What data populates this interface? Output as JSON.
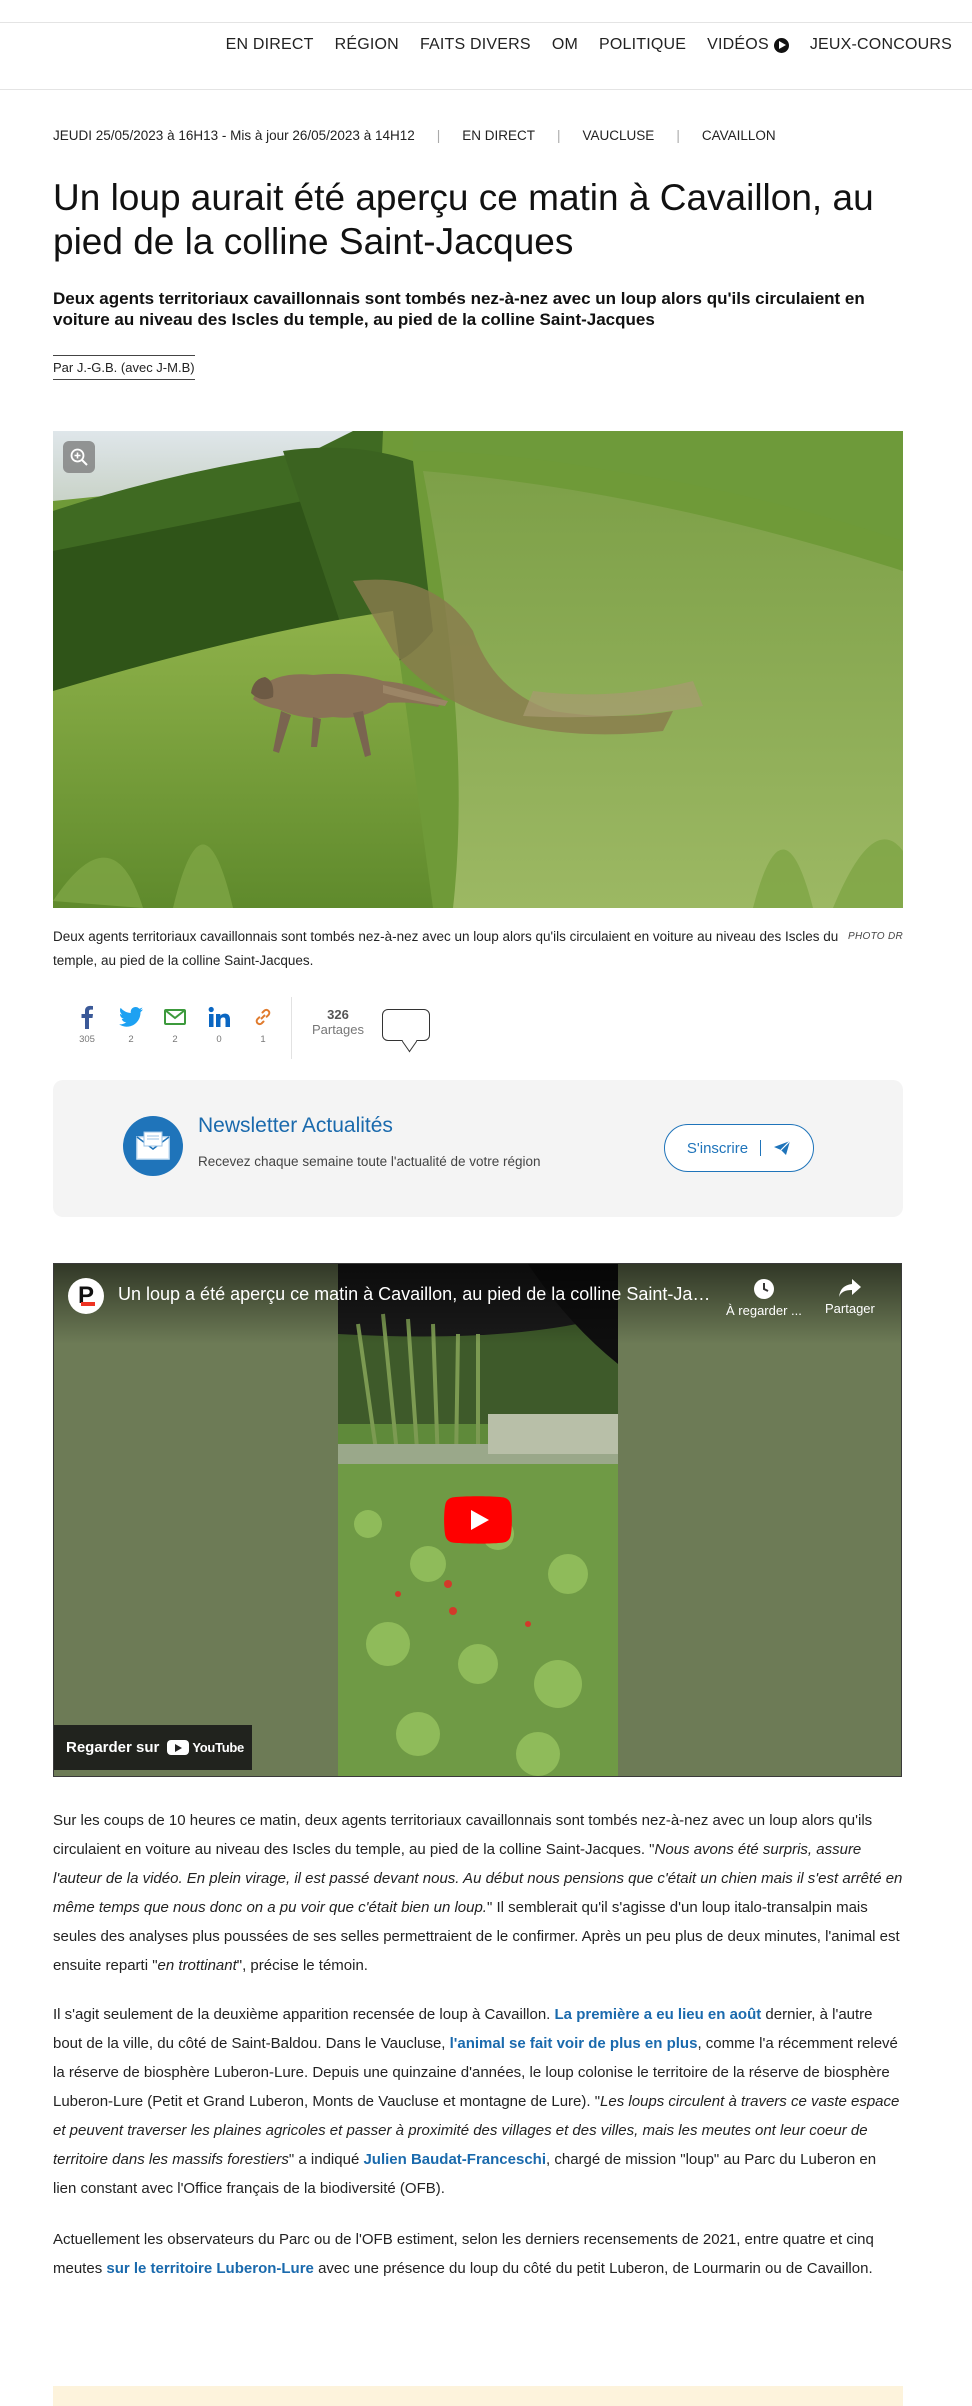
{
  "nav": {
    "items": [
      "EN DIRECT",
      "RÉGION",
      "FAITS DIVERS",
      "OM",
      "POLITIQUE",
      "VIDÉOS",
      "JEUX-CONCOURS"
    ]
  },
  "article": {
    "date": "JEUDI 25/05/2023 à 16H13 - Mis à jour 26/05/2023 à 14H12",
    "tags": [
      "EN DIRECT",
      "VAUCLUSE",
      "CAVAILLON"
    ],
    "title": "Un loup aurait été aperçu ce matin à Cavaillon, au pied de la colline Saint-Jacques",
    "lead": "Deux agents territoriaux cavaillonnais sont tombés nez-à-nez avec un loup alors qu'ils circulaient en voiture au niveau des Iscles du temple, au pied de la colline Saint-Jacques",
    "author": "Par J.-G.B. (avec J-M.B)",
    "photo_caption": "Deux agents territoriaux cavaillonnais sont tombés nez-à-nez avec un loup alors qu'ils circulaient en voiture au niveau des Iscles du temple, au pied de la colline Saint-Jacques.",
    "photo_credit": "PHOTO DR"
  },
  "share": {
    "items": [
      {
        "icon": "facebook-icon",
        "count": "305"
      },
      {
        "icon": "twitter-icon",
        "count": "2"
      },
      {
        "icon": "email-icon",
        "count": "2"
      },
      {
        "icon": "linkedin-icon",
        "count": "0"
      },
      {
        "icon": "link-icon",
        "count": "1"
      }
    ],
    "total": "326",
    "total_label": "Partages"
  },
  "newsletter": {
    "title": "Newsletter Actualités",
    "subtitle": "Recevez chaque semaine toute l'actualité de votre région",
    "button": "S'inscrire"
  },
  "video": {
    "title": "Un loup a été aperçu ce matin à Cavaillon, au pied de la colline Saint-Jacques",
    "watch_later": "À regarder ...",
    "share": "Partager",
    "watch_on": "Regarder sur",
    "youtube": "YouTube"
  },
  "paragraphs": {
    "p1": [
      {
        "t": "Sur les coups de 10 heures ce matin, deux agents territoriaux cavaillonnais sont tombés nez-à-nez avec un loup alors qu'ils circulaient en voiture au niveau des Iscles du temple, au pied de la colline Saint-Jacques. \""
      },
      {
        "t": "Nous avons été surpris, assure l'auteur de la vidéo. En plein virage, il est passé devant nous. Au début nous pensions que c'était un chien mais il s'est arrêté en même temps que nous donc on a pu voir que c'était bien un loup.",
        "em": true
      },
      {
        "t": "\" Il semblerait qu'il s'agisse d'un loup italo-transalpin mais seules des analyses plus poussées de ses selles permettraient de le confirmer. Après un peu plus de deux minutes, l'animal est ensuite reparti \""
      },
      {
        "t": "en trottinant",
        "em": true
      },
      {
        "t": "\", précise le témoin."
      }
    ],
    "p2": [
      {
        "t": "Il s'agit seulement de la deuxième apparition recensée de loup à Cavaillon. "
      },
      {
        "t": "La première a eu lieu en août",
        "link": true
      },
      {
        "t": " dernier, à l'autre bout de la ville, du côté de Saint-Baldou. Dans le Vaucluse, "
      },
      {
        "t": "l'animal se fait voir de plus en plus",
        "link": true
      },
      {
        "t": ", comme l'a récemment relevé la réserve de biosphère Luberon-Lure. Depuis une quinzaine d'années, le loup colonise le territoire de la réserve de biosphère Luberon-Lure (Petit et Grand Luberon, Monts de Vaucluse et montagne de Lure). \""
      },
      {
        "t": "Les loups circulent à travers ce vaste espace et peuvent traverser les plaines agricoles et passer à proximité des villages et des villes, mais les meutes ont leur coeur de territoire dans les massifs forestiers",
        "em": true
      },
      {
        "t": "\" a indiqué "
      },
      {
        "t": "Julien Baudat-Franceschi",
        "link": true
      },
      {
        "t": ", chargé de mission \"loup\" au Parc du Luberon en lien constant avec l'Office français de la biodiversité (OFB)."
      }
    ],
    "p3": [
      {
        "t": "Actuellement les observateurs du Parc ou de l'OFB estiment, selon les derniers recensements de 2021, entre quatre et cinq meutes "
      },
      {
        "t": "sur le territoire Luberon-Lure",
        "link": true
      },
      {
        "t": " avec une présence du loup du côté du petit Luberon, de Lourmarin ou de Cavaillon."
      }
    ]
  }
}
